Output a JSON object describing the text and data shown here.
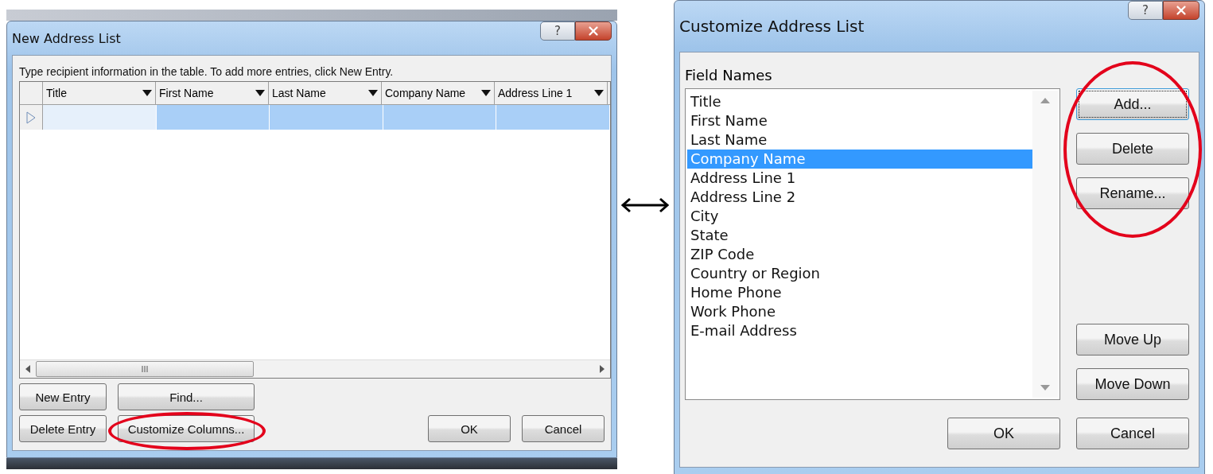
{
  "new_address_list": {
    "title": "New Address List",
    "help_button": "?",
    "instruction": "Type recipient information in the table.  To add more entries, click New Entry.",
    "columns": [
      "Title",
      "First Name",
      "Last Name",
      "Company Name",
      "Address Line 1"
    ],
    "new_row": {
      "selected": true
    },
    "left_buttons": [
      {
        "label": "New Entry",
        "circled": false
      },
      {
        "label": "Find...",
        "circled": false
      },
      {
        "label": "Delete Entry",
        "circled": false
      },
      {
        "label": "Customize Columns...",
        "circled": true
      }
    ],
    "dialog_buttons": [
      "OK",
      "Cancel"
    ]
  },
  "customize_address_list": {
    "title": "Customize Address List",
    "help_button": "?",
    "list_label": "Field Names",
    "fields": [
      {
        "label": "Title",
        "selected": false
      },
      {
        "label": "First Name",
        "selected": false
      },
      {
        "label": "Last Name",
        "selected": false
      },
      {
        "label": "Company Name",
        "selected": true
      },
      {
        "label": "Address Line 1",
        "selected": false
      },
      {
        "label": "Address Line 2",
        "selected": false
      },
      {
        "label": "City",
        "selected": false
      },
      {
        "label": "State",
        "selected": false
      },
      {
        "label": "ZIP Code",
        "selected": false
      },
      {
        "label": "Country or Region",
        "selected": false
      },
      {
        "label": "Home Phone",
        "selected": false
      },
      {
        "label": "Work Phone",
        "selected": false
      },
      {
        "label": "E-mail Address",
        "selected": false
      }
    ],
    "edit_buttons": {
      "circled": true,
      "items": [
        {
          "label": "Add...",
          "focused": true
        },
        {
          "label": "Delete",
          "focused": false
        },
        {
          "label": "Rename...",
          "focused": false
        }
      ]
    },
    "move_buttons": [
      "Move Up",
      "Move Down"
    ],
    "dialog_buttons": [
      "OK",
      "Cancel"
    ]
  }
}
